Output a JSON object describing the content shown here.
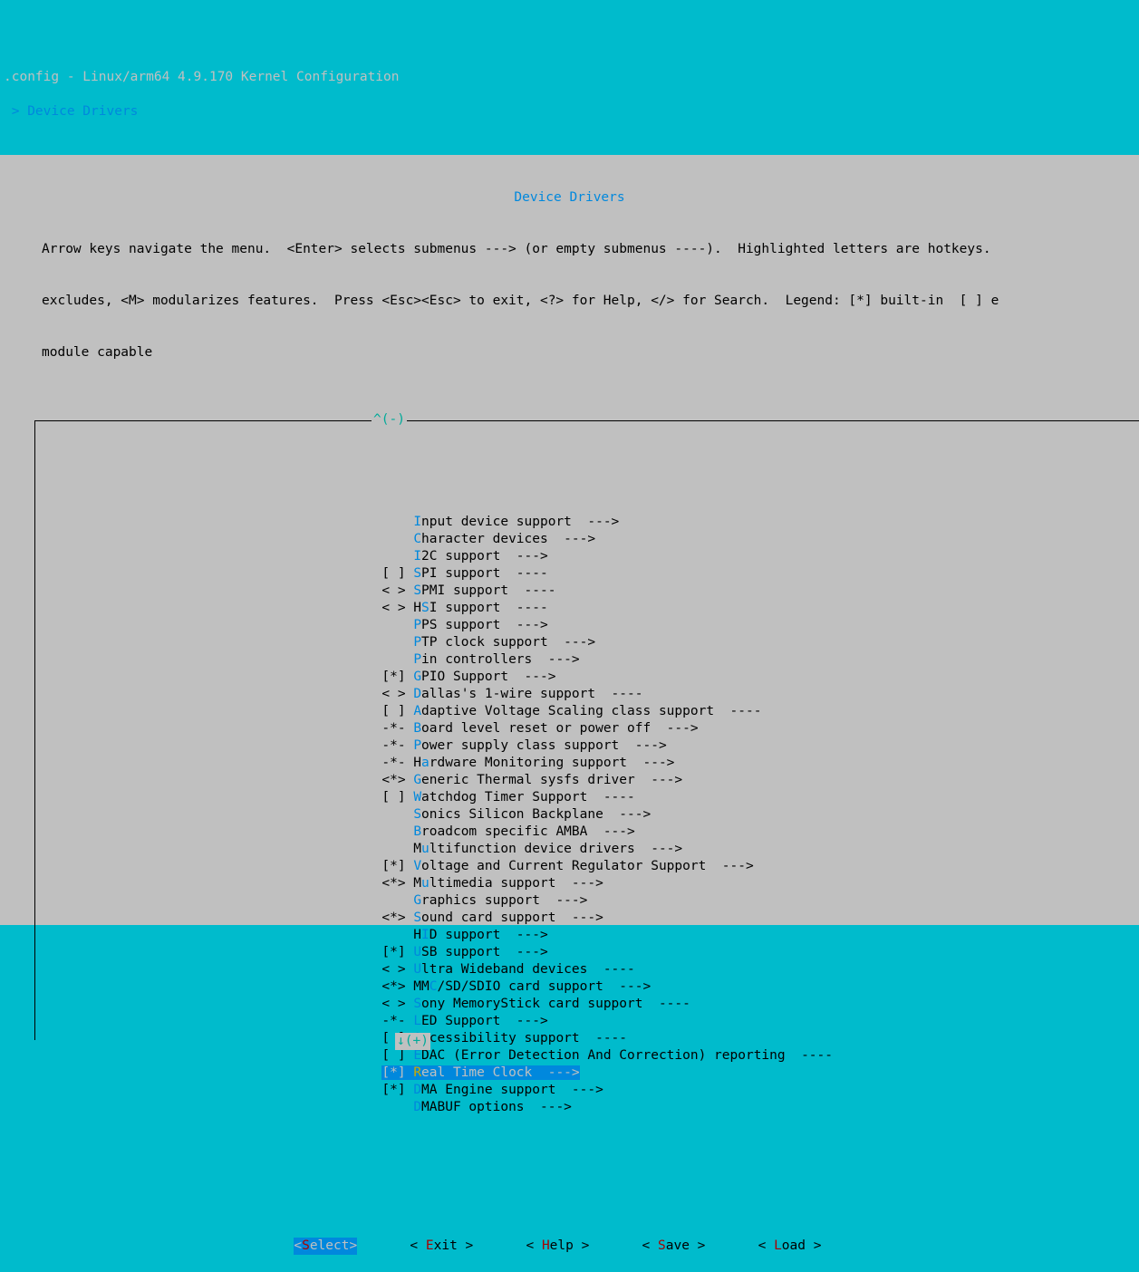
{
  "title_bar": ".config - Linux/arm64 4.9.170 Kernel Configuration",
  "breadcrumb": " > Device Drivers ",
  "header": {
    "title": "Device Drivers",
    "help_line1": "Arrow keys navigate the menu.  <Enter> selects submenus ---> (or empty submenus ----).  Highlighted letters are hotkeys.",
    "help_line2": "excludes, <M> modularizes features.  Press <Esc><Esc> to exit, <?> for Help, </> for Search.  Legend: [*] built-in  [ ] e",
    "help_line3": "module capable"
  },
  "scroll": {
    "up": "^(-)",
    "down": "↓(+)"
  },
  "items": [
    {
      "prefix": "    ",
      "hot": "I",
      "rest": "nput device support  --->"
    },
    {
      "prefix": "    ",
      "hot": "C",
      "rest": "haracter devices  --->"
    },
    {
      "prefix": "    ",
      "hot": "I",
      "rest": "2C support  --->"
    },
    {
      "prefix": "[ ] ",
      "hot": "S",
      "rest": "PI support  ----"
    },
    {
      "prefix": "< > ",
      "hot": "S",
      "rest": "PMI support  ----"
    },
    {
      "prefix": "< > H",
      "hot": "S",
      "rest": "I support  ----"
    },
    {
      "prefix": "    ",
      "hot": "P",
      "rest": "PS support  --->"
    },
    {
      "prefix": "    ",
      "hot": "P",
      "rest": "TP clock support  --->"
    },
    {
      "prefix": "    ",
      "hot": "P",
      "rest": "in controllers  --->"
    },
    {
      "prefix": "[*] ",
      "hot": "G",
      "rest": "PIO Support  --->"
    },
    {
      "prefix": "< > ",
      "hot": "D",
      "rest": "allas's 1-wire support  ----"
    },
    {
      "prefix": "[ ] ",
      "hot": "A",
      "rest": "daptive Voltage Scaling class support  ----"
    },
    {
      "prefix": "-*- ",
      "hot": "B",
      "rest": "oard level reset or power off  --->"
    },
    {
      "prefix": "-*- ",
      "hot": "P",
      "rest": "ower supply class support  --->"
    },
    {
      "prefix": "-*- H",
      "hot": "a",
      "rest": "rdware Monitoring support  --->"
    },
    {
      "prefix": "<*> ",
      "hot": "G",
      "rest": "eneric Thermal sysfs driver  --->"
    },
    {
      "prefix": "[ ] ",
      "hot": "W",
      "rest": "atchdog Timer Support  ----"
    },
    {
      "prefix": "    ",
      "hot": "S",
      "rest": "onics Silicon Backplane  --->"
    },
    {
      "prefix": "    ",
      "hot": "B",
      "rest": "roadcom specific AMBA  --->"
    },
    {
      "prefix": "    M",
      "hot": "u",
      "rest": "ltifunction device drivers  --->"
    },
    {
      "prefix": "[*] ",
      "hot": "V",
      "rest": "oltage and Current Regulator Support  --->"
    },
    {
      "prefix": "<*> M",
      "hot": "u",
      "rest": "ltimedia support  --->"
    },
    {
      "prefix": "    ",
      "hot": "G",
      "rest": "raphics support  --->"
    },
    {
      "prefix": "<*> ",
      "hot": "S",
      "rest": "ound card support  --->"
    },
    {
      "prefix": "    H",
      "hot": "I",
      "rest": "D support  --->"
    },
    {
      "prefix": "[*] ",
      "hot": "U",
      "rest": "SB support  --->"
    },
    {
      "prefix": "< > ",
      "hot": "U",
      "rest": "ltra Wideband devices  ----"
    },
    {
      "prefix": "<*> MM",
      "hot": "C",
      "rest": "/SD/SDIO card support  --->"
    },
    {
      "prefix": "< > ",
      "hot": "S",
      "rest": "ony MemoryStick card support  ----"
    },
    {
      "prefix": "-*- ",
      "hot": "L",
      "rest": "ED Support  --->"
    },
    {
      "prefix": "[ ] ",
      "hot": "A",
      "rest": "ccessibility support  ----"
    },
    {
      "prefix": "[ ] ",
      "hot": "E",
      "rest": "DAC (Error Detection And Correction) reporting  ----"
    },
    {
      "prefix": "[*] ",
      "hot": "R",
      "rest": "eal Time Clock  --->",
      "selected": true
    },
    {
      "prefix": "[*] ",
      "hot": "D",
      "rest": "MA Engine support  --->"
    },
    {
      "prefix": "    ",
      "hot": "D",
      "rest": "MABUF options  --->"
    }
  ],
  "buttons": [
    {
      "open": "<",
      "hot": "S",
      "rest": "elect>",
      "selected": true
    },
    {
      "open": "< ",
      "hot": "E",
      "rest": "xit >"
    },
    {
      "open": "< ",
      "hot": "H",
      "rest": "elp >"
    },
    {
      "open": "< ",
      "hot": "S",
      "rest": "ave >"
    },
    {
      "open": "< ",
      "hot": "L",
      "rest": "oad >"
    }
  ]
}
